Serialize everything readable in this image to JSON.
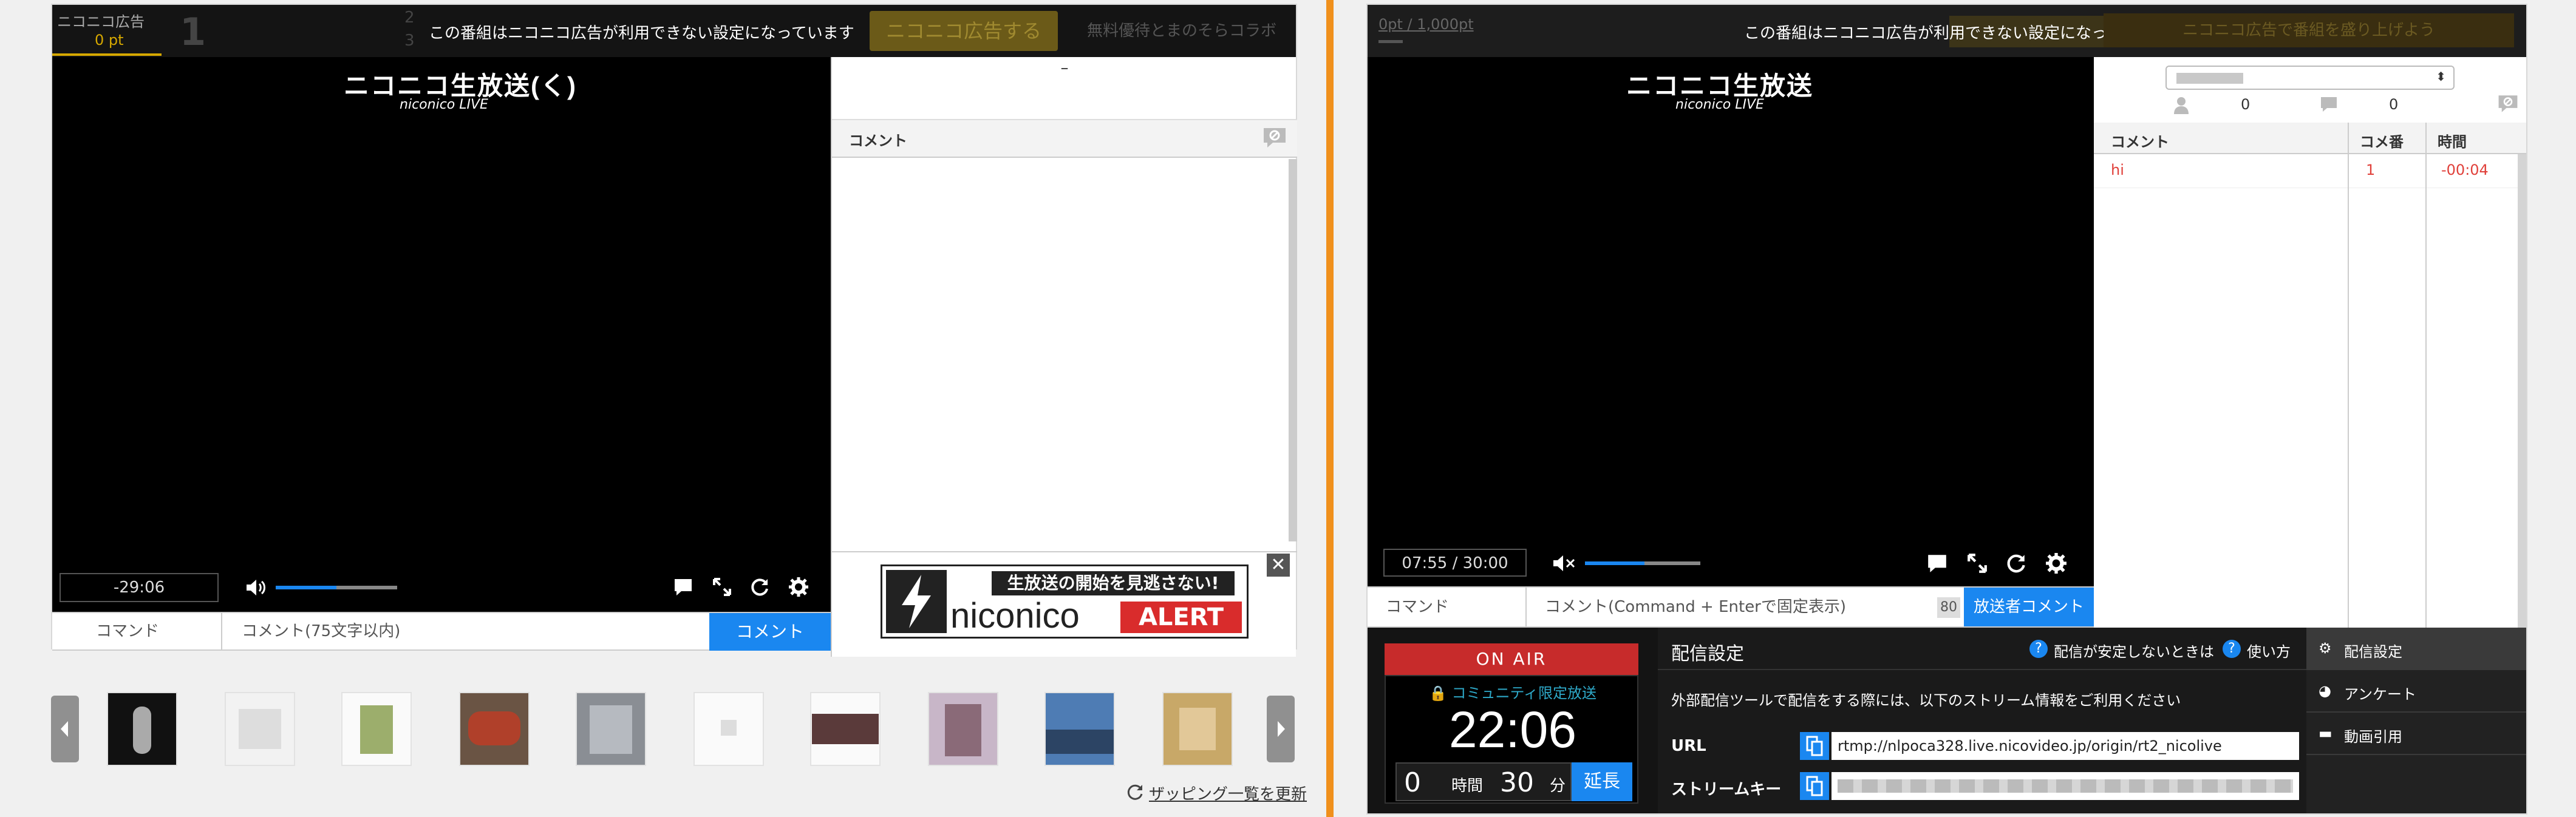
{
  "left": {
    "top_notice": "この番組はニコニコ広告が利用できない設定になっています",
    "ad_label": "ニコニコ広告",
    "ad_pt": "0 pt",
    "ad_rank": "1",
    "ad_rank2": "2",
    "ad_rank3": "3",
    "ad_button": "ニコニコ広告する",
    "ad_link": "無料優待とまのそらコラボ",
    "logo_main": "ニコニコ生放送(く)",
    "logo_sub": "niconico LIVE",
    "time": "-29:06",
    "comment_panel_title": "コメント",
    "dash": "–",
    "command_label": "コマンド",
    "comment_placeholder": "コメント(75文字以内)",
    "comment_button": "コメント",
    "alert_banner_top": "生放送の開始を見逃さない!",
    "alert_banner_brand": "niconico",
    "alert_banner_tag": "ALERT",
    "refresh_link": "ザッピング一覧を更新"
  },
  "right": {
    "points": "0pt / 1,000pt",
    "top_notice": "この番組はニコニコ広告が利用できない設定になっています",
    "ad_cta": "ニコニコ広告で番組を盛り上げよう",
    "logo_main": "ニコニコ生放送",
    "logo_sub": "niconico LIVE",
    "time": "07:55 / 30:00",
    "viewer_count": "0",
    "comment_count": "0",
    "table_headers": [
      "コメント",
      "コメ番",
      "時間"
    ],
    "rows": [
      {
        "comment": "hi",
        "num": "1",
        "time": "-00:04"
      }
    ],
    "command_label": "コマンド",
    "comment_placeholder": "コメント(Command + Enterで固定表示)",
    "char_count": "80",
    "broadcaster_button": "放送者コメント",
    "on_air": "ON AIR",
    "community_label": "コミュニティ限定放送",
    "clock": "22:06",
    "ext_hours": "0",
    "hours_label": "時間",
    "ext_minutes": "30",
    "minutes_label": "分",
    "extend_button": "延長",
    "settings_title": "配信設定",
    "help_unstable": "配信が安定しないときは",
    "help_usage": "使い方",
    "settings_desc": "外部配信ツールで配信をする際には、以下のストリーム情報をご利用ください",
    "url_label": "URL",
    "url_value": "rtmp://nlpoca328.live.nicovideo.jp/origin/rt2_nicolive",
    "stream_key_label": "ストリームキー",
    "menu": [
      "配信設定",
      "アンケート",
      "動画引用"
    ]
  },
  "colors": {
    "accent": "#1a87f0",
    "divider": "#f0901c",
    "onair": "#c72b2b",
    "comment_red": "#e0403a"
  }
}
